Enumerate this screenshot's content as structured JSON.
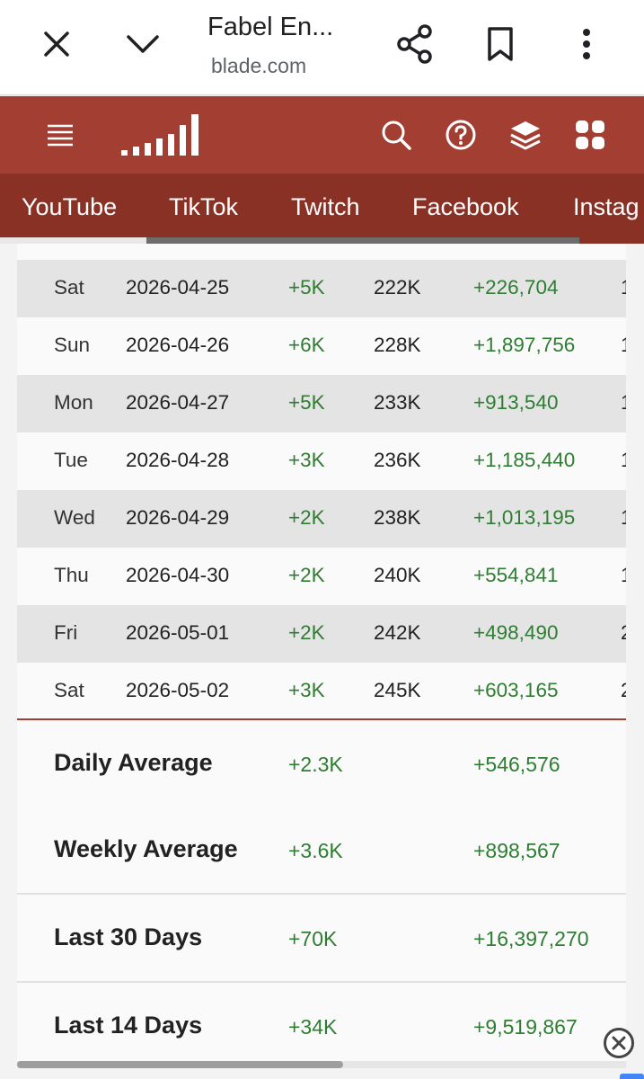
{
  "browser": {
    "title": "Fabel En...",
    "url": "blade.com",
    "icons": [
      "close-icon",
      "chevron-down-icon",
      "share-icon",
      "bookmark-icon",
      "more-vert-icon"
    ]
  },
  "site_header": {
    "brand_color": "#a23f32",
    "icons": [
      "menu-icon",
      "logo-bars-icon",
      "search-icon",
      "help-icon",
      "layers-icon",
      "apps-icon"
    ]
  },
  "tabs": [
    {
      "label": "YouTube"
    },
    {
      "label": "TikTok"
    },
    {
      "label": "Twitch"
    },
    {
      "label": "Facebook"
    },
    {
      "label": "Instag"
    }
  ],
  "daily_rows": [
    {
      "day": "Sat",
      "date": "2026-04-25",
      "sub_change": "+5K",
      "subs": "222K",
      "view_change": "+226,704",
      "more": "1"
    },
    {
      "day": "Sun",
      "date": "2026-04-26",
      "sub_change": "+6K",
      "subs": "228K",
      "view_change": "+1,897,756",
      "more": "1"
    },
    {
      "day": "Mon",
      "date": "2026-04-27",
      "sub_change": "+5K",
      "subs": "233K",
      "view_change": "+913,540",
      "more": "1"
    },
    {
      "day": "Tue",
      "date": "2026-04-28",
      "sub_change": "+3K",
      "subs": "236K",
      "view_change": "+1,185,440",
      "more": "1"
    },
    {
      "day": "Wed",
      "date": "2026-04-29",
      "sub_change": "+2K",
      "subs": "238K",
      "view_change": "+1,013,195",
      "more": "1"
    },
    {
      "day": "Thu",
      "date": "2026-04-30",
      "sub_change": "+2K",
      "subs": "240K",
      "view_change": "+554,841",
      "more": "1"
    },
    {
      "day": "Fri",
      "date": "2026-05-01",
      "sub_change": "+2K",
      "subs": "242K",
      "view_change": "+498,490",
      "more": "2"
    },
    {
      "day": "Sat",
      "date": "2026-05-02",
      "sub_change": "+3K",
      "subs": "245K",
      "view_change": "+603,165",
      "more": "2"
    }
  ],
  "summary": [
    {
      "label": "Daily Average",
      "sub_change": "+2.3K",
      "view_change": "+546,576"
    },
    {
      "label": "Weekly Average",
      "sub_change": "+3.6K",
      "view_change": "+898,567"
    },
    {
      "label": "Last 30 Days",
      "sub_change": "+70K",
      "view_change": "+16,397,270"
    },
    {
      "label": "Last 14 Days",
      "sub_change": "+34K",
      "view_change": "+9,519,867"
    }
  ],
  "colors": {
    "positive": "#2e7d32",
    "header": "#a23f32",
    "tabs_bg": "#8a3126"
  }
}
